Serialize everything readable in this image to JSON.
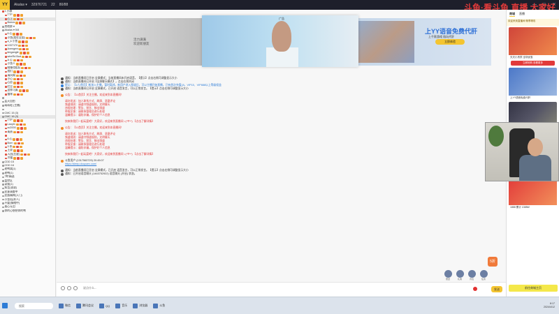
{
  "titlebar": {
    "logo": "YY",
    "items": [
      "Akalas ▾",
      "32976721",
      "22",
      "80/88"
    ],
    "controls": [
      "—",
      "□",
      "✕"
    ],
    "watermark": "斗鱼·看斗鱼 直播 大家好"
  },
  "left_panel": {
    "rows": [
      {
        "text": "1 小群",
        "indent": false,
        "dot": "r"
      },
      {
        "text": "TTP",
        "indent": true,
        "dot": "r"
      },
      {
        "text": "心上",
        "indent": true,
        "dot": "r",
        "sel": true
      },
      {
        "text": "Bonus",
        "indent": true,
        "dot": "r"
      },
      {
        "text": "其他群 ▾",
        "indent": false,
        "dot": "g"
      },
      {
        "text": "Akalas ▾ 5/8",
        "indent": false,
        "dot": "g"
      },
      {
        "text": "6 心",
        "indent": true,
        "dot": "r"
      },
      {
        "text": "小鱼(我在全国)",
        "indent": true,
        "dot": "r"
      },
      {
        "text": "a_k 小鱼",
        "indent": true,
        "dot": "r"
      },
      {
        "text": "1007170",
        "indent": true,
        "dot": "r"
      },
      {
        "text": "Avengers",
        "indent": true,
        "dot": "r"
      },
      {
        "text": "kingangle",
        "indent": true,
        "dot": "r"
      },
      {
        "text": "wireRd Bud",
        "indent": true,
        "dot": "r"
      },
      {
        "text": "A 心",
        "indent": true,
        "dot": "r"
      },
      {
        "text": "小鱼人",
        "indent": true,
        "dot": "r"
      },
      {
        "text": "结婚也组队",
        "indent": true,
        "dot": "r"
      },
      {
        "text": "我们",
        "indent": true,
        "dot": "r"
      },
      {
        "text": "清风阁",
        "indent": true,
        "dot": "r"
      },
      {
        "text": "小心",
        "indent": true,
        "dot": "r"
      },
      {
        "text": "心愿",
        "indent": true,
        "dot": "r"
      },
      {
        "text": "红豆",
        "indent": true,
        "dot": "r"
      },
      {
        "text": "这样可真",
        "indent": true,
        "dot": "r"
      },
      {
        "text": "猫咪",
        "indent": true,
        "dot": "r"
      },
      {
        "text": "",
        "indent": false,
        "dot": "g"
      },
      {
        "text": "蓝天自由",
        "indent": false,
        "dot": "g"
      },
      {
        "text": "萌萌哒 (主播)",
        "indent": false,
        "dot": "g"
      },
      {
        "text": "",
        "indent": false,
        "dot": "g"
      },
      {
        "text": "CMC 15 (3)",
        "indent": false,
        "dot": "g"
      },
      {
        "text": "CMC 16 (3)",
        "indent": false,
        "dot": "g",
        "sel": true
      },
      {
        "text": "TTP",
        "indent": true,
        "dot": "r"
      },
      {
        "text": "Laoyin",
        "indent": true,
        "dot": "r"
      },
      {
        "text": "zc2000",
        "indent": true,
        "dot": "r"
      },
      {
        "text": "青燕",
        "indent": true,
        "dot": "r"
      },
      {
        "text": "",
        "indent": true,
        "dot": "r"
      },
      {
        "text": "6 心",
        "indent": true,
        "dot": "r"
      },
      {
        "text": "Born",
        "indent": true,
        "dot": "r"
      },
      {
        "text": "3 本",
        "indent": true,
        "dot": "r"
      },
      {
        "text": "土豪",
        "indent": true,
        "dot": "r"
      },
      {
        "text": "入团(五星)",
        "indent": true,
        "dot": "r"
      },
      {
        "text": "冷霜",
        "indent": true,
        "dot": "r"
      },
      {
        "text": "CDD 15",
        "indent": false,
        "dot": "g"
      },
      {
        "text": "CDD 16",
        "indent": false,
        "dot": "g"
      },
      {
        "text": "老鸭窝(1)",
        "indent": false,
        "dot": "g"
      },
      {
        "text": "老鸭(1)",
        "indent": false,
        "dot": "g"
      },
      {
        "text": "\"鸭\"精选",
        "indent": false,
        "dot": "g"
      },
      {
        "text": "监控区",
        "indent": false,
        "dot": "g"
      },
      {
        "text": "读报(1)",
        "indent": false,
        "dot": "g"
      },
      {
        "text": "知音(说说)",
        "indent": false,
        "dot": "g"
      },
      {
        "text": "民意调查中",
        "indent": false,
        "dot": "g"
      },
      {
        "text": "民族精神(入门)",
        "indent": false,
        "dot": "g"
      },
      {
        "text": "小金仙(本人)",
        "indent": false,
        "dot": "g"
      },
      {
        "text": "不要(情绪中)",
        "indent": false,
        "dot": "g"
      },
      {
        "text": "孤心无泪",
        "indent": false,
        "dot": "g"
      },
      {
        "text": "你的心想把你的鸭",
        "indent": false,
        "dot": "g"
      }
    ]
  },
  "banner": {
    "left_text": [
      "活力满满",
      "欢迎新朋友"
    ],
    "center_ad": "广告",
    "right_title": "上YY语音免费代肝",
    "right_sub": "上千款游戏 陪玩代肝",
    "right_btn": "立即体验"
  },
  "chat": {
    "messages": [
      {
        "icon": "dark",
        "style": "",
        "text": "通知：当前直播间已开启 全屏模式；当前直播间未开启语音。【提示】点击右侧可调整显示大小"
      },
      {
        "icon": "dark",
        "style": "",
        "text": "通知：当前直播间已开启【全屏聊天模式】，点击右侧关闭"
      },
      {
        "icon": "blue",
        "style": "blue",
        "text": "提示：【1人/首页】新加入主播，暂时离线，新用户进入频道后，可以主播开始直播，已有首次充值18，VIP15、VIP888以上等级权益"
      },
      {
        "icon": "dark",
        "style": "",
        "text": "通知：当前直播间已开启 全屏模式，已开启 语音发言，可以正常发言。【提示】点击右侧可调整显示大小"
      },
      {
        "icon": "",
        "style": "gap",
        "text": ""
      },
      {
        "icon": "orange",
        "style": "red",
        "text": "公告：【11首页】关注主播，欢迎来到本直播间！"
      },
      {
        "icon": "",
        "style": "gap",
        "text": ""
      },
      {
        "icon": "",
        "style": "red",
        "text": "请勿发送：加人联系方式、刷屏、恶意评论"
      },
      {
        "icon": "",
        "style": "red",
        "text": "频道规则：请遵守频道规则，文明聊天"
      },
      {
        "icon": "",
        "style": "red",
        "text": "违规处理：警告、禁言、移出频道"
      },
      {
        "icon": "",
        "style": "red",
        "text": "举报反馈：请联系管理员进行处理"
      },
      {
        "icon": "",
        "style": "red",
        "text": "温馨提示：谨防诈骗，保护好个人信息"
      },
      {
        "icon": "",
        "style": "gap",
        "text": ""
      },
      {
        "icon": "",
        "style": "red",
        "text": "快来和我们一起玩耍吧！大家好，欢迎来到直播间 ♪(^∇^*) 【点击了解详情】"
      },
      {
        "icon": "",
        "style": "gap",
        "text": ""
      },
      {
        "icon": "orange",
        "style": "red",
        "text": "公告：【11首页】关注主播，欢迎来到本直播间！"
      },
      {
        "icon": "",
        "style": "gap",
        "text": ""
      },
      {
        "icon": "",
        "style": "red",
        "text": "请勿发送：加人联系方式、刷屏、恶意评论"
      },
      {
        "icon": "",
        "style": "red",
        "text": "频道规则：请遵守频道规则，文明聊天"
      },
      {
        "icon": "",
        "style": "red",
        "text": "违规处理：警告、禁言、移出频道"
      },
      {
        "icon": "",
        "style": "red",
        "text": "举报反馈：请联系管理员进行处理"
      },
      {
        "icon": "",
        "style": "red",
        "text": "温馨提示：谨防诈骗，保护好个人信息"
      },
      {
        "icon": "",
        "style": "gap",
        "text": ""
      },
      {
        "icon": "",
        "style": "red",
        "text": "快来和我们一起玩耍吧！大家好，欢迎来到直播间 ♪(^∇^*) 【点击了解详情】"
      },
      {
        "icon": "",
        "style": "gap",
        "text": ""
      },
      {
        "icon": "orange",
        "style": "",
        "text": "斗鱼用户 (1317563729) 20:45:07"
      },
      {
        "icon": "",
        "style": "link",
        "text": "https://sleep.douyuex.com/"
      },
      {
        "icon": "",
        "style": "gap",
        "text": ""
      },
      {
        "icon": "dark",
        "style": "",
        "text": "通知：当前直播间已开启 全屏模式，已开启 语音发言，可以正常发言。【提示】点击右侧可调整显示大小"
      },
      {
        "icon": "dark",
        "style": "",
        "text": "通知：已开启语音聊天 (1463752922) 语音聊天 (开启) 状态。"
      }
    ]
  },
  "gifts": [
    {
      "label": "赠送"
    },
    {
      "label": "礼物"
    },
    {
      "label": "背包"
    },
    {
      "label": "任务"
    }
  ],
  "float_badge": "5折",
  "input": {
    "placeholder": "说点什么..."
  },
  "send_label": "发送",
  "right_panel": {
    "tabs": [
      "商城",
      "直播"
    ],
    "notice": "欢迎来到直播间 畅享精彩",
    "cards": [
      {
        "title": "天天小贵宾 全场优惠",
        "price": "",
        "btn": "立即抢购 查看更多",
        "style": "red"
      },
      {
        "title": "上YY语音免费代肝",
        "price": "",
        "btn": "",
        "style": "blue"
      },
      {
        "title": "精品套装 限时特惠",
        "price": "¥49",
        "btn": "",
        "style": "dark"
      },
      {
        "title": "天天手游 · V9 · 【全站】",
        "price": "¥2050",
        "btn": "",
        "style": "dark"
      },
      {
        "title": "1888 累计 1388W",
        "price": "",
        "btn": "",
        "style": "red2"
      }
    ],
    "bottom_btn": "前往商城主页"
  },
  "taskbar": {
    "search": "搜索",
    "items": [
      "微信",
      "腾讯会议",
      "QQ",
      "音乐",
      "浏览器",
      "斗鱼"
    ],
    "time": "8:17",
    "date": "2024/4/12"
  }
}
